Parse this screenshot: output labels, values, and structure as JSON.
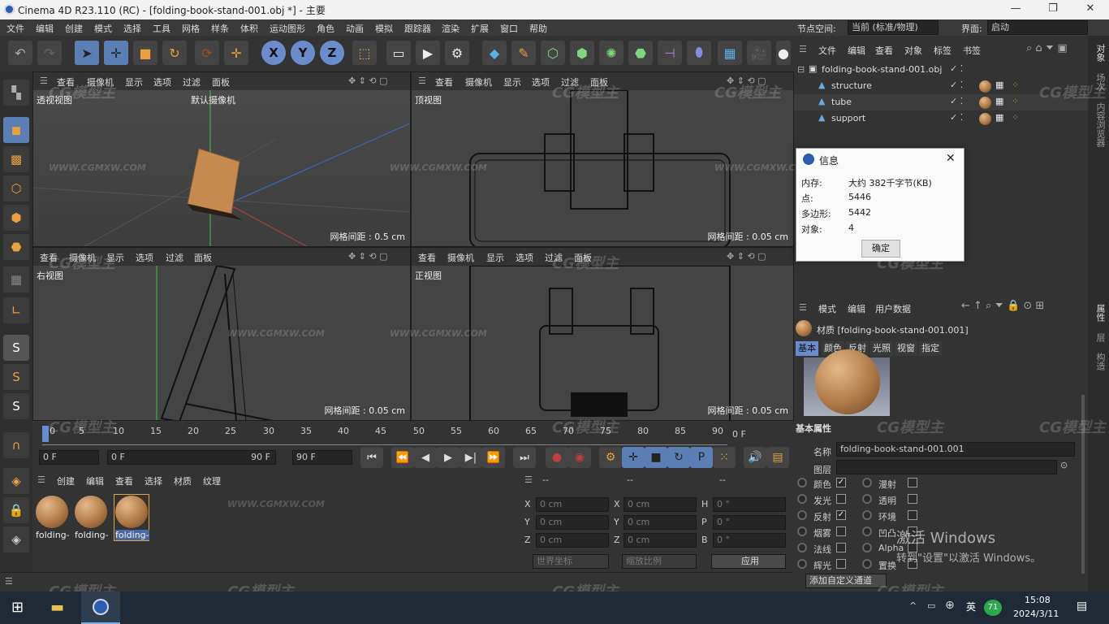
{
  "titlebar": {
    "title": "Cinema 4D R23.110 (RC) - [folding-book-stand-001.obj *] - 主要",
    "min": "—",
    "max": "❐",
    "close": "✕"
  },
  "menu": {
    "items": [
      "文件",
      "编辑",
      "创建",
      "模式",
      "选择",
      "工具",
      "网格",
      "样条",
      "体积",
      "运动图形",
      "角色",
      "动画",
      "模拟",
      "跟踪器",
      "渲染",
      "扩展",
      "窗口",
      "帮助"
    ],
    "node_space_label": "节点空间:",
    "node_space_value": "当前 (标准/物理)",
    "interface_label": "界面:",
    "interface_value": "启动"
  },
  "viewports": {
    "menu": [
      "查看",
      "摄像机",
      "显示",
      "选项",
      "过滤",
      "面板"
    ],
    "perspective": {
      "label": "透视视图",
      "camera": "默认摄像机",
      "grid": "网格间距 : 0.5 cm"
    },
    "top": {
      "label": "顶视图",
      "grid": "网格间距 : 0.05 cm"
    },
    "right": {
      "label": "右视图",
      "grid": "网格间距 : 0.05 cm"
    },
    "front": {
      "label": "正视图",
      "grid": "网格间距 : 0.05 cm"
    }
  },
  "timeline": {
    "ticks": [
      "0",
      "5",
      "10",
      "15",
      "20",
      "25",
      "30",
      "35",
      "40",
      "45",
      "50",
      "55",
      "60",
      "65",
      "70",
      "75",
      "80",
      "85",
      "90"
    ],
    "end_label": "0 F",
    "current_frame": "0 F",
    "min_frame": "0 F",
    "max_frame": "90 F",
    "end_frame": "90 F"
  },
  "material_manager": {
    "menu": [
      "创建",
      "编辑",
      "查看",
      "选择",
      "材质",
      "纹理"
    ],
    "materials": [
      "folding-",
      "folding-",
      "folding-"
    ]
  },
  "coordinates": {
    "header": [
      "--",
      "--",
      "--"
    ],
    "rows": [
      {
        "a": "X",
        "av": "0 cm",
        "b": "X",
        "bv": "0 cm",
        "c": "H",
        "cv": "0 °"
      },
      {
        "a": "Y",
        "av": "0 cm",
        "b": "Y",
        "bv": "0 cm",
        "c": "P",
        "cv": "0 °"
      },
      {
        "a": "Z",
        "av": "0 cm",
        "b": "Z",
        "bv": "0 cm",
        "c": "B",
        "cv": "0 °"
      }
    ],
    "world_coords": "世界坐标",
    "scale": "缩放比例",
    "apply": "应用"
  },
  "object_manager": {
    "menu": [
      "文件",
      "编辑",
      "查看",
      "对象",
      "标签",
      "书签"
    ],
    "root": "folding-book-stand-001.obj",
    "children": [
      "structure",
      "tube",
      "support"
    ]
  },
  "info_dialog": {
    "title": "信息",
    "rows": [
      {
        "k": "内存:",
        "v": "大约 382千字节(KB)"
      },
      {
        "k": "点:",
        "v": "5446"
      },
      {
        "k": "多边形:",
        "v": "5442"
      },
      {
        "k": "对象:",
        "v": "4"
      }
    ],
    "ok": "确定"
  },
  "attribute_manager": {
    "menu": [
      "模式",
      "编辑",
      "用户数据"
    ],
    "material_title": "材质 [folding-book-stand-001.001]",
    "tabs": [
      "基本",
      "颜色",
      "反射",
      "光照",
      "视窗",
      "指定"
    ],
    "section": "基本属性",
    "name_label": "名称",
    "name_value": "folding-book-stand-001.001",
    "layer_label": "图层",
    "channels_left": [
      {
        "label": "颜色",
        "checked": "✓"
      },
      {
        "label": "发光",
        "checked": ""
      },
      {
        "label": "反射",
        "checked": "✓"
      },
      {
        "label": "烟雾",
        "checked": ""
      },
      {
        "label": "法线",
        "checked": ""
      },
      {
        "label": "辉光",
        "checked": ""
      }
    ],
    "channels_right": [
      {
        "label": "漫射",
        "checked": ""
      },
      {
        "label": "透明",
        "checked": ""
      },
      {
        "label": "环境",
        "checked": ""
      },
      {
        "label": "凹凸",
        "checked": ""
      },
      {
        "label": "Alpha",
        "checked": ""
      },
      {
        "label": "置换",
        "checked": ""
      }
    ],
    "add_channel": "添加自定义通道"
  },
  "right_strip": {
    "tab1": "对象",
    "tab2": "场次",
    "tab3": "内容浏览器",
    "tab4": "属性",
    "tab5": "层",
    "tab6": "构造"
  },
  "activation": {
    "line1": "激活 Windows",
    "line2": "转到\"设置\"以激活 Windows。"
  },
  "watermarks": {
    "brand": "CG模型主",
    "url": "WWW.CGMXW.COM"
  },
  "taskbar": {
    "ime": "英",
    "badge": "71",
    "time": "15:08",
    "date": "2024/3/11"
  }
}
